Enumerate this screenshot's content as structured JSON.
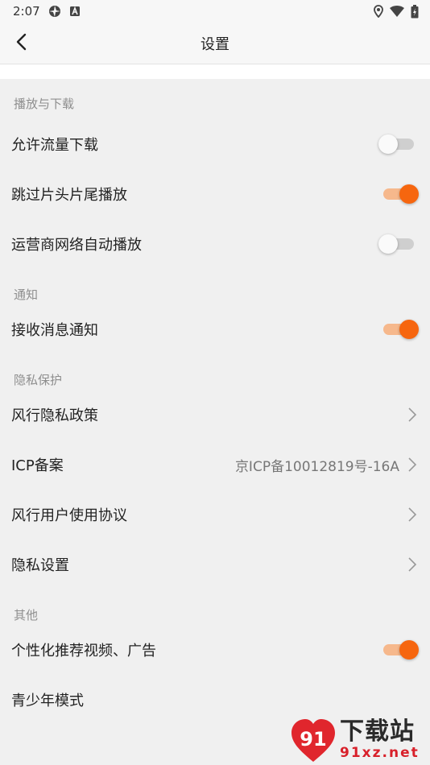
{
  "status_bar": {
    "time": "2:07"
  },
  "header": {
    "title": "设置"
  },
  "sections": {
    "playback": {
      "title": "播放与下载",
      "items": [
        {
          "label": "允许流量下载",
          "toggle": false
        },
        {
          "label": "跳过片头片尾播放",
          "toggle": true
        },
        {
          "label": "运营商网络自动播放",
          "toggle": false
        }
      ]
    },
    "notify": {
      "title": "通知",
      "items": [
        {
          "label": "接收消息通知",
          "toggle": true
        }
      ]
    },
    "privacy": {
      "title": "隐私保护",
      "items": [
        {
          "label": "风行隐私政策"
        },
        {
          "label": "ICP备案",
          "value": "京ICP备10012819号-16A"
        },
        {
          "label": "风行用户使用协议"
        },
        {
          "label": "隐私设置"
        }
      ]
    },
    "other": {
      "title": "其他",
      "items": [
        {
          "label": "个性化推荐视频、广告",
          "toggle": true
        },
        {
          "label": "青少年模式"
        }
      ]
    }
  },
  "watermark": {
    "logo_text": "91",
    "big_text": "下载站",
    "small_text": "91xz.net"
  },
  "colors": {
    "accent": "#f6660f",
    "accent_track": "#f6b88c",
    "off_track": "#cfcfcf",
    "background": "#f0f0f0"
  }
}
